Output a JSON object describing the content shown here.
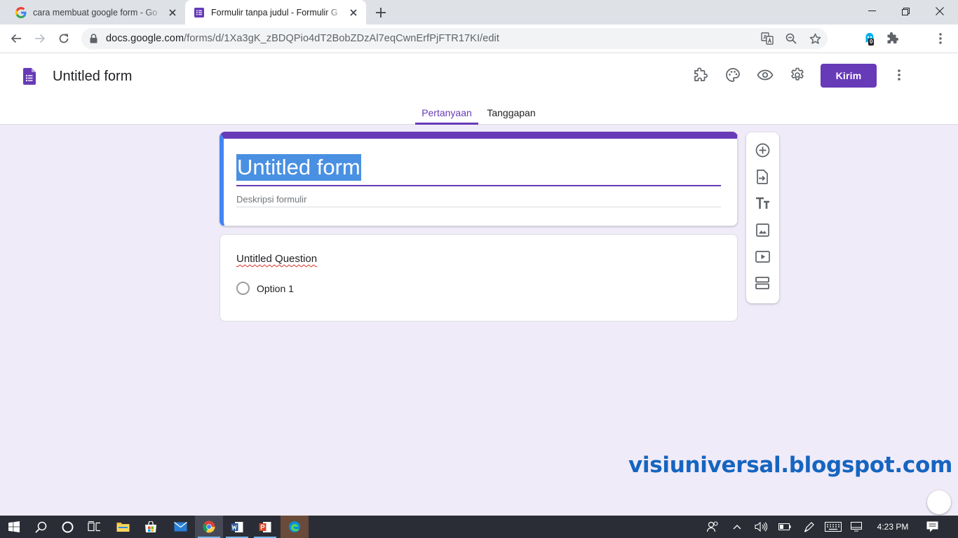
{
  "browser": {
    "tabs": [
      {
        "title": "cara membuat google form - Go",
        "favicon": "google-g-icon",
        "active": false
      },
      {
        "title": "Formulir tanpa judul - Formulir G",
        "favicon": "google-forms-icon",
        "active": true
      }
    ],
    "url_host": "docs.google.com",
    "url_path": "/forms/d/1Xa3gK_zBDQPio4dT2BobZDzAl7eqCwnErfPjFTR17KI/edit",
    "extension_badge": "0"
  },
  "header": {
    "doc_title": "Untitled form",
    "send_label": "Kirim",
    "icons": [
      "addon-puzzle-icon",
      "palette-icon",
      "preview-eye-icon",
      "settings-gear-icon",
      "more-vert-icon"
    ]
  },
  "form_tabs": [
    {
      "label": "Pertanyaan",
      "active": true
    },
    {
      "label": "Tanggapan",
      "active": false
    }
  ],
  "form": {
    "title": "Untitled form",
    "description_placeholder": "Deskripsi formulir",
    "question": {
      "title": "Untitled Question",
      "options": [
        "Option 1"
      ]
    }
  },
  "side_toolbar": [
    "add-question-icon",
    "import-questions-icon",
    "add-title-text-icon",
    "add-image-icon",
    "add-video-icon",
    "add-section-icon"
  ],
  "watermark": "visiuniversal.blogspot.com",
  "taskbar": {
    "time": "4:23 PM",
    "apps": [
      "start-icon",
      "search-icon",
      "cortana-icon",
      "task-view-icon",
      "file-explorer-icon",
      "store-icon",
      "mail-icon",
      "chrome-icon",
      "word-icon",
      "powerpoint-icon",
      "edge-icon"
    ]
  },
  "colors": {
    "brand_purple": "#673ab7",
    "page_bg": "#f0ebf8",
    "title_accent": "#4285f4",
    "watermark": "#1565c0"
  }
}
